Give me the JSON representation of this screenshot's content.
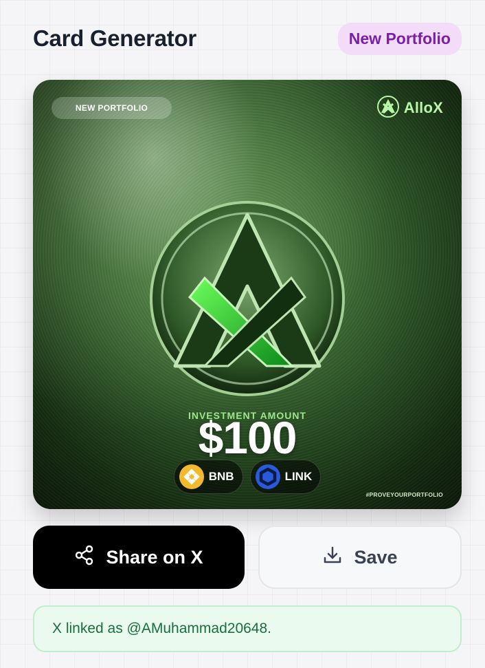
{
  "header": {
    "title": "Card Generator",
    "badge": "New Portfolio"
  },
  "card": {
    "tag": "NEW PORTFOLIO",
    "brand_name": "AlloX",
    "investment_label": "INVESTMENT AMOUNT",
    "investment_amount": "$100",
    "tokens": [
      {
        "symbol": "BNB",
        "icon": "bnb-icon",
        "color": "#f3ba2f"
      },
      {
        "symbol": "LINK",
        "icon": "chainlink-icon",
        "color": "#2a5ada"
      }
    ],
    "hashtag": "#PROVEYOURPORTFOLIO"
  },
  "actions": {
    "share_label": "Share on X",
    "share_icon": "share-icon",
    "save_label": "Save",
    "save_icon": "download-icon"
  },
  "notice": {
    "text": "X linked as @AMuhammad20648."
  },
  "colors": {
    "accent_purple": "#7a1fa8",
    "badge_bg": "#f2dcf7",
    "success_green": "#17703c",
    "success_bg": "#ebfaef"
  }
}
